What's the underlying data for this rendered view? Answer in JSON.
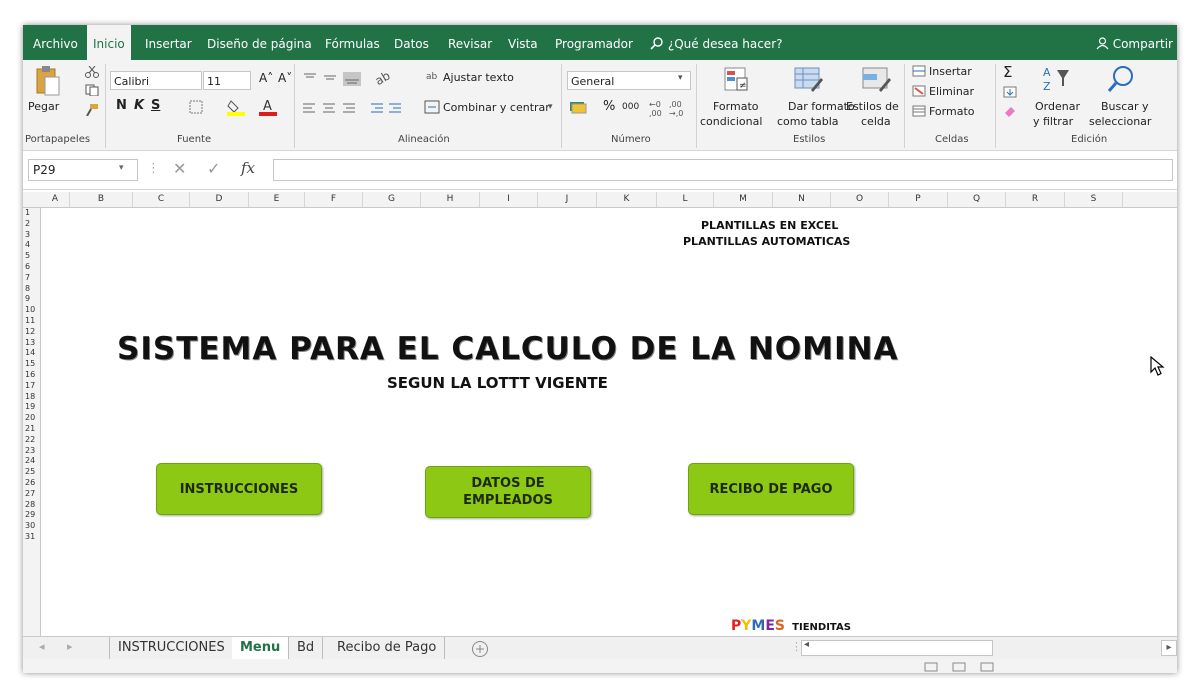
{
  "ribbon_tabs": [
    "Archivo",
    "Inicio",
    "Insertar",
    "Diseño de página",
    "Fórmulas",
    "Datos",
    "Revisar",
    "Vista",
    "Programador"
  ],
  "active_tab": "Inicio",
  "tell_me": "¿Qué desea hacer?",
  "share": "Compartir",
  "clipboard": {
    "paste": "Pegar",
    "label": "Portapapeles"
  },
  "font": {
    "name": "Calibri",
    "size": "11",
    "bold": "N",
    "italic": "K",
    "underline": "S",
    "label": "Fuente"
  },
  "alignment": {
    "wrap": "Ajustar texto",
    "merge": "Combinar y centrar",
    "label": "Alineación"
  },
  "number": {
    "format": "General",
    "percent": "%",
    "thousands": "000",
    "label": "Número"
  },
  "styles": {
    "conditional_1": "Formato",
    "conditional_2": "condicional",
    "table_1": "Dar formato",
    "table_2": "como tabla",
    "cell_1": "Estilos de",
    "cell_2": "celda",
    "label": "Estilos"
  },
  "cells": {
    "insert": "Insertar",
    "delete": "Eliminar",
    "format": "Formato",
    "label": "Celdas"
  },
  "editing": {
    "sort_1": "Ordenar",
    "sort_2": "y filtrar",
    "find_1": "Buscar y",
    "find_2": "seleccionar",
    "label": "Edición"
  },
  "name_box": "P29",
  "fx": "fx",
  "formula_value": "",
  "columns": [
    "A",
    "B",
    "C",
    "D",
    "E",
    "F",
    "G",
    "H",
    "I",
    "J",
    "K",
    "L",
    "M",
    "N",
    "O",
    "P",
    "Q",
    "R",
    "S"
  ],
  "rows": [
    "1",
    "2",
    "3",
    "4",
    "5",
    "6",
    "7",
    "8",
    "9",
    "10",
    "11",
    "12",
    "13",
    "14",
    "15",
    "16",
    "17",
    "18",
    "19",
    "20",
    "21",
    "22",
    "23",
    "24",
    "25",
    "26",
    "27",
    "28",
    "29",
    "30",
    "31"
  ],
  "sheet": {
    "note_1": "PLANTILLAS EN EXCEL",
    "note_2": "PLANTILLAS AUTOMATICAS",
    "title": "SISTEMA PARA EL CALCULO DE LA NOMINA",
    "subtitle": "SEGUN LA LOTTT VIGENTE",
    "btn_instructions": "INSTRUCCIONES",
    "btn_employees_1": "DATOS DE",
    "btn_employees_2": "EMPLEADOS",
    "btn_receipt": "RECIBO DE PAGO",
    "brand_logo": "PYMES",
    "brand_name": "TIENDITAS"
  },
  "sheet_tabs": [
    "INSTRUCCIONES",
    "Menu",
    "Bd",
    "Recibo de Pago"
  ],
  "active_sheet": "Menu",
  "colors": {
    "excel_green": "#217346",
    "button_green": "#8cc814"
  }
}
